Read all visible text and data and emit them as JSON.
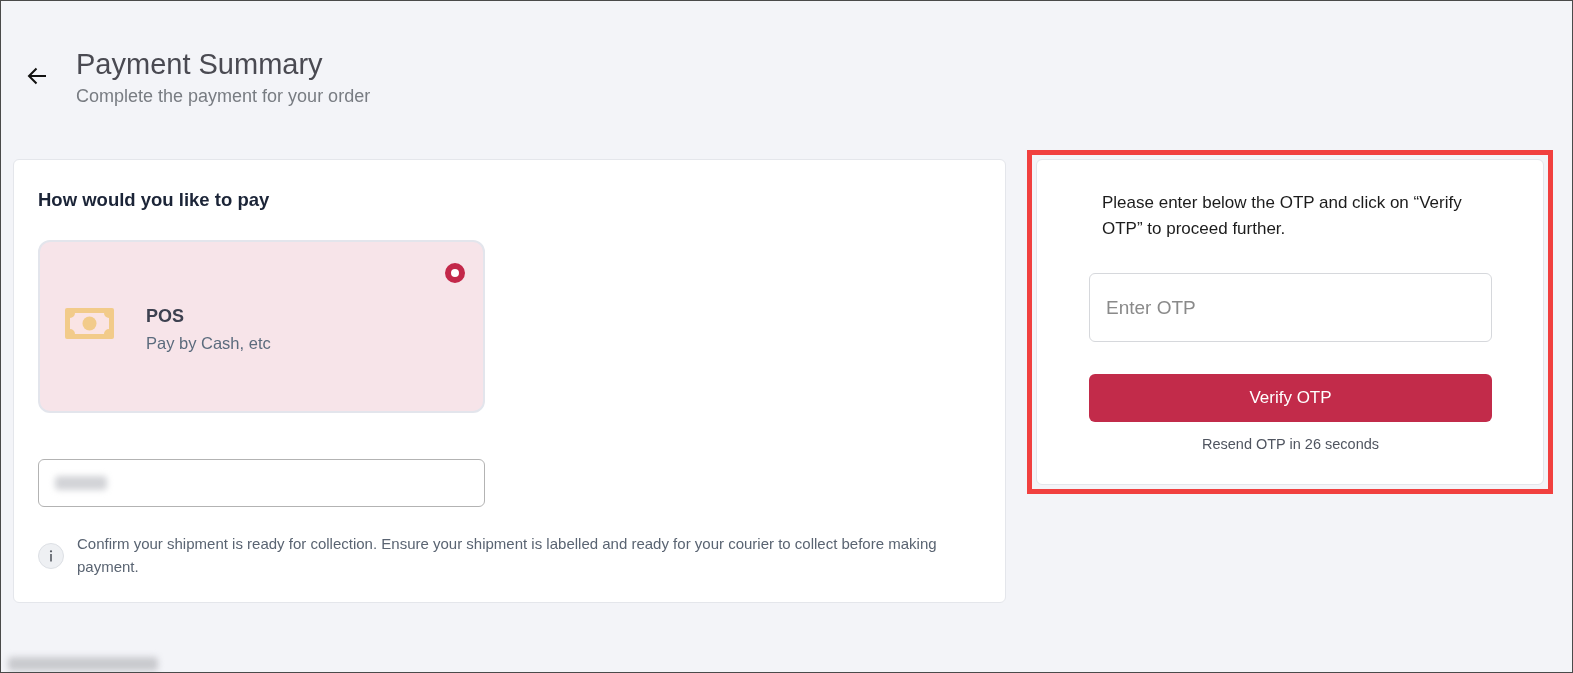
{
  "header": {
    "title": "Payment Summary",
    "subtitle": "Complete the payment for your order"
  },
  "payment": {
    "heading": "How would you like to pay",
    "options": [
      {
        "title": "POS",
        "description": "Pay by Cash, etc",
        "selected": true
      }
    ],
    "reference_field": {
      "redacted": true
    },
    "notice": "Confirm your shipment is ready for collection. Ensure your shipment is labelled and ready for your courier to collect before making payment."
  },
  "otp_panel": {
    "highlighted": true,
    "instruction": "Please enter below the OTP and click on “Verify OTP” to proceed further.",
    "otp_field": {
      "placeholder": "Enter OTP"
    },
    "button": "Verify OTP",
    "resend": "Resend OTP in 26 seconds"
  },
  "next_section": {
    "redacted": true
  }
}
